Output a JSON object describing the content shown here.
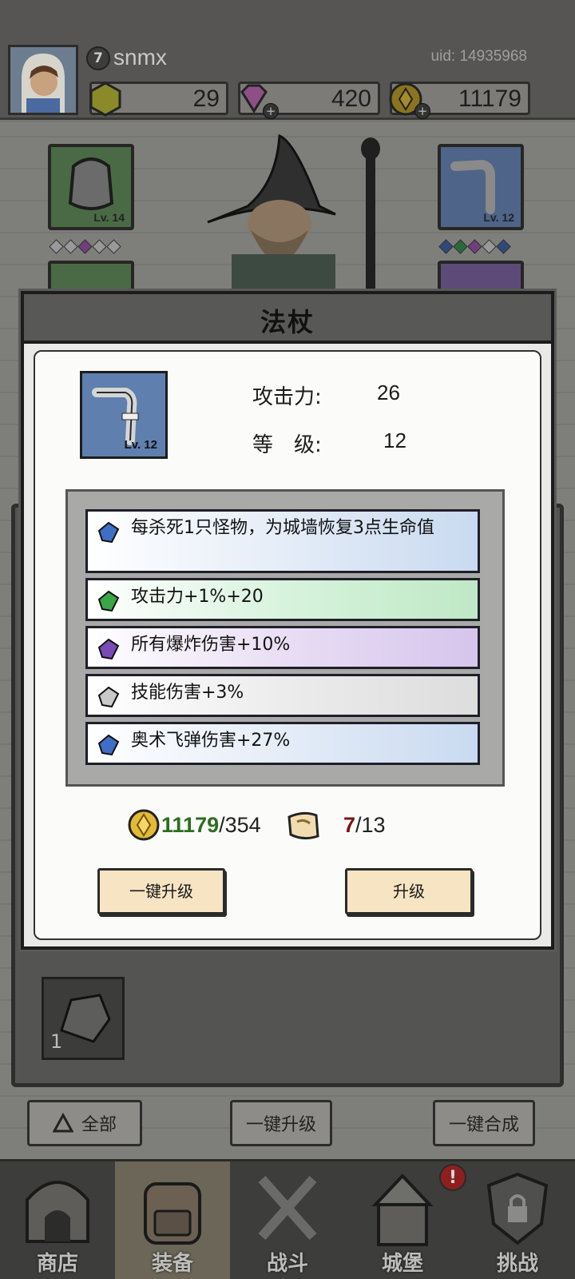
{
  "player": {
    "level": "7",
    "name": "snmx",
    "uid": "uid: 14935968"
  },
  "resources": {
    "energy": "29",
    "gems": "420",
    "gold": "11179"
  },
  "slots": {
    "left_top_level": "Lv. 14",
    "right_top_level": "Lv. 12"
  },
  "inventory": {
    "item_count": "1"
  },
  "actions": {
    "filter_label": "全部",
    "upgrade_all_label": "一键升级",
    "merge_all_label": "一键合成"
  },
  "nav": {
    "tabs": [
      {
        "label": "商店"
      },
      {
        "label": "装备"
      },
      {
        "label": "战斗"
      },
      {
        "label": "城堡"
      },
      {
        "label": "挑战"
      }
    ],
    "notification": "!"
  },
  "modal": {
    "title": "法杖",
    "item_level": "Lv. 12",
    "stats": {
      "attack_label": "攻击力:",
      "attack_value": "26",
      "level_label": "等　级:",
      "level_value": "12"
    },
    "attributes": [
      {
        "text": "每杀死1只怪物，为城墙恢复3点生命值",
        "rarity": "blue"
      },
      {
        "text": "攻击力+1%+20",
        "rarity": "green"
      },
      {
        "text": "所有爆炸伤害+10%",
        "rarity": "purple"
      },
      {
        "text": "技能伤害+3%",
        "rarity": "white"
      },
      {
        "text": "奥术飞弹伤害+27%",
        "rarity": "blue"
      }
    ],
    "cost": {
      "gold_have": "11179",
      "gold_need": "/354",
      "scroll_have": "7",
      "scroll_need": "/13"
    },
    "buttons": {
      "upgrade_all": "一键升级",
      "upgrade": "升级"
    }
  },
  "colors": {
    "rarity_blue": "#3f6fc4",
    "rarity_green": "#3aa646",
    "rarity_purple": "#7a4bb5",
    "rarity_white": "#c9c9c9",
    "gold_have": "#2d6d1f",
    "scroll_have": "#7b1414",
    "button_bg": "#f6e4c3"
  }
}
